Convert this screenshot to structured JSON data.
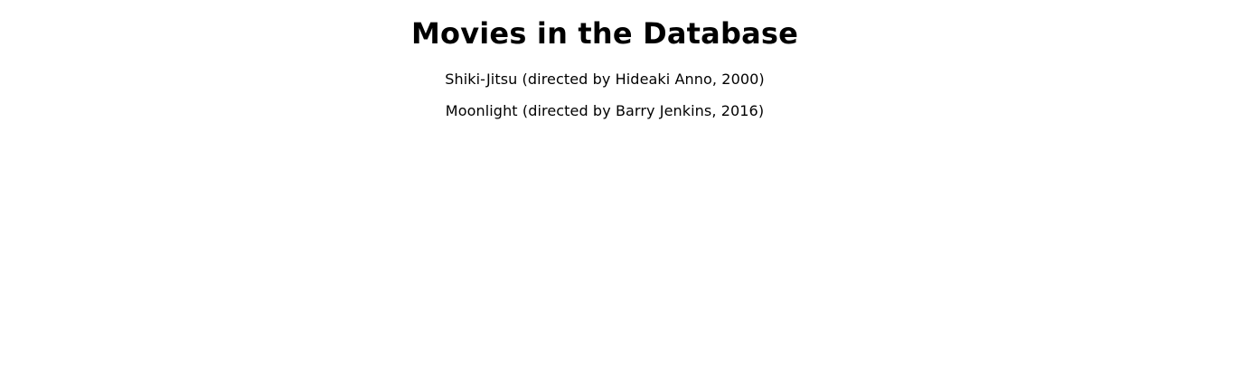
{
  "page": {
    "title": "Movies in the Database"
  },
  "movies": [
    {
      "text": "Shiki-Jitsu (directed by Hideaki Anno, 2000)"
    },
    {
      "text": "Moonlight (directed by Barry Jenkins, 2016)"
    }
  ]
}
